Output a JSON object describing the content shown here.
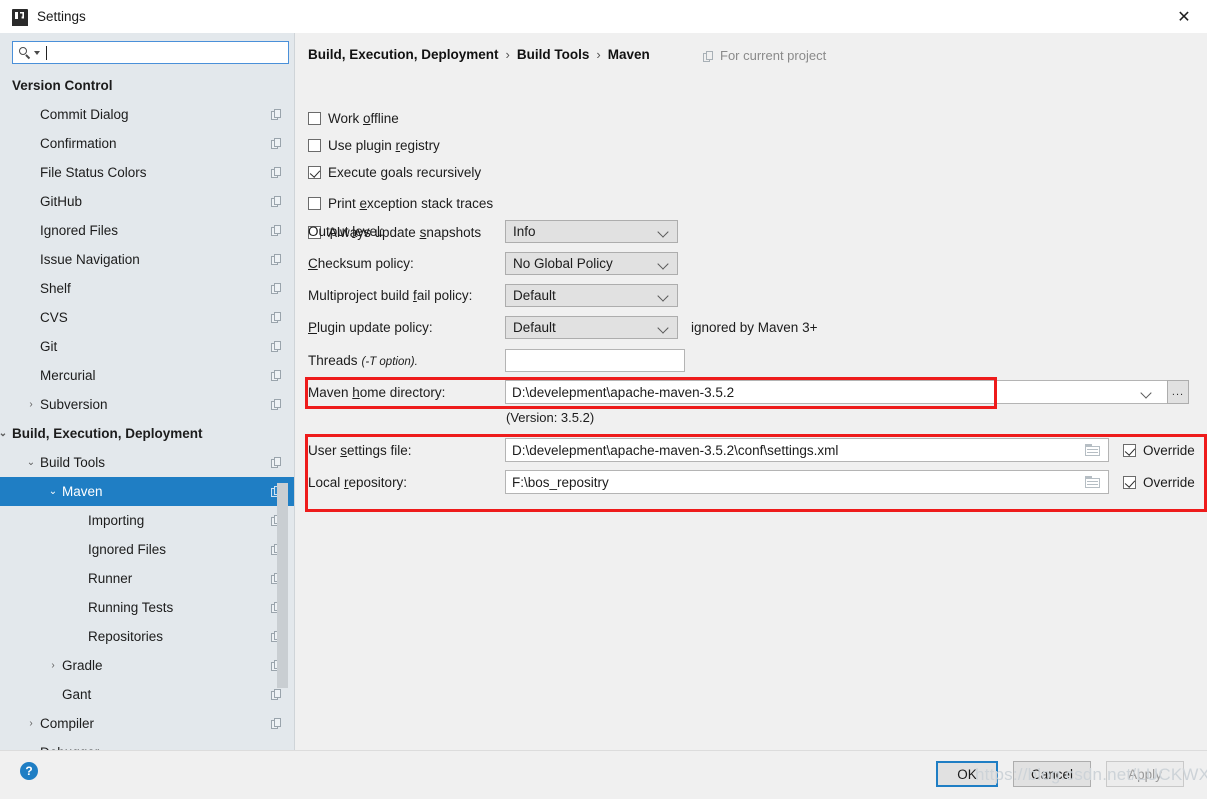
{
  "window": {
    "title": "Settings",
    "icon": "intellij-idea-icon",
    "close_label": "✕"
  },
  "sidebar": {
    "search": {
      "value": "",
      "placeholder": "",
      "icon": "search-icon"
    },
    "items": [
      {
        "label": "Version Control",
        "indent": 0,
        "bold": true,
        "arrow": "",
        "copy": false,
        "selected": false
      },
      {
        "label": "Commit Dialog",
        "indent": 1,
        "bold": false,
        "arrow": "",
        "copy": true,
        "selected": false
      },
      {
        "label": "Confirmation",
        "indent": 1,
        "bold": false,
        "arrow": "",
        "copy": true,
        "selected": false
      },
      {
        "label": "File Status Colors",
        "indent": 1,
        "bold": false,
        "arrow": "",
        "copy": true,
        "selected": false
      },
      {
        "label": "GitHub",
        "indent": 1,
        "bold": false,
        "arrow": "",
        "copy": true,
        "selected": false
      },
      {
        "label": "Ignored Files",
        "indent": 1,
        "bold": false,
        "arrow": "",
        "copy": true,
        "selected": false
      },
      {
        "label": "Issue Navigation",
        "indent": 1,
        "bold": false,
        "arrow": "",
        "copy": true,
        "selected": false
      },
      {
        "label": "Shelf",
        "indent": 1,
        "bold": false,
        "arrow": "",
        "copy": true,
        "selected": false
      },
      {
        "label": "CVS",
        "indent": 1,
        "bold": false,
        "arrow": "",
        "copy": true,
        "selected": false
      },
      {
        "label": "Git",
        "indent": 1,
        "bold": false,
        "arrow": "",
        "copy": true,
        "selected": false
      },
      {
        "label": "Mercurial",
        "indent": 1,
        "bold": false,
        "arrow": "",
        "copy": true,
        "selected": false
      },
      {
        "label": "Subversion",
        "indent": 1,
        "bold": false,
        "arrow": "›",
        "copy": true,
        "selected": false
      },
      {
        "label": "Build, Execution, Deployment",
        "indent": 0,
        "bold": true,
        "arrow": "⌄",
        "copy": false,
        "selected": false
      },
      {
        "label": "Build Tools",
        "indent": 1,
        "bold": false,
        "arrow": "⌄",
        "copy": true,
        "selected": false
      },
      {
        "label": "Maven",
        "indent": 2,
        "bold": false,
        "arrow": "⌄",
        "copy": true,
        "selected": true
      },
      {
        "label": "Importing",
        "indent": 3,
        "bold": false,
        "arrow": "",
        "copy": true,
        "selected": false
      },
      {
        "label": "Ignored Files",
        "indent": 3,
        "bold": false,
        "arrow": "",
        "copy": true,
        "selected": false
      },
      {
        "label": "Runner",
        "indent": 3,
        "bold": false,
        "arrow": "",
        "copy": true,
        "selected": false
      },
      {
        "label": "Running Tests",
        "indent": 3,
        "bold": false,
        "arrow": "",
        "copy": true,
        "selected": false
      },
      {
        "label": "Repositories",
        "indent": 3,
        "bold": false,
        "arrow": "",
        "copy": true,
        "selected": false
      },
      {
        "label": "Gradle",
        "indent": 2,
        "bold": false,
        "arrow": "›",
        "copy": true,
        "selected": false
      },
      {
        "label": "Gant",
        "indent": 2,
        "bold": false,
        "arrow": "",
        "copy": true,
        "selected": false
      },
      {
        "label": "Compiler",
        "indent": 1,
        "bold": false,
        "arrow": "›",
        "copy": true,
        "selected": false
      },
      {
        "label": "Debugger",
        "indent": 1,
        "bold": false,
        "arrow": "›",
        "copy": false,
        "selected": false
      }
    ]
  },
  "main": {
    "breadcrumb": [
      "Build, Execution, Deployment",
      "Build Tools",
      "Maven"
    ],
    "breadcrumb_separator": "›",
    "for_current_project": "For current project",
    "checkboxes": [
      {
        "label_pre": "Work ",
        "label_mnemonic": "o",
        "label_post": "ffline",
        "checked": false
      },
      {
        "label_pre": "Use plugin ",
        "label_mnemonic": "r",
        "label_post": "egistry",
        "checked": false
      },
      {
        "label_pre": "Execute ",
        "label_mnemonic": "g",
        "label_post": "oals recursively",
        "checked": true
      },
      {
        "label_pre": "Print ",
        "label_mnemonic": "e",
        "label_post": "xception stack traces",
        "checked": false
      },
      {
        "label_pre": "Always update ",
        "label_mnemonic": "s",
        "label_post": "napshots",
        "checked": false
      }
    ],
    "combos": [
      {
        "label_pre": "Output ",
        "label_mnemonic": "l",
        "label_post": "evel:",
        "value": "Info",
        "hint": ""
      },
      {
        "label_pre": "",
        "label_mnemonic": "C",
        "label_post": "hecksum policy:",
        "value": "No Global Policy",
        "hint": ""
      },
      {
        "label_pre": "Multiproject build ",
        "label_mnemonic": "f",
        "label_post": "ail policy:",
        "value": "Default",
        "hint": ""
      },
      {
        "label_pre": "",
        "label_mnemonic": "P",
        "label_post": "lugin update policy:",
        "value": "Default",
        "hint": "ignored by Maven 3+"
      }
    ],
    "threads": {
      "label": "Threads",
      "note": "(-T option).",
      "value": "",
      "placeholder": ""
    },
    "maven_home": {
      "label_pre": "Maven ",
      "label_mnemonic": "h",
      "label_post": "ome directory:",
      "value": "D:\\develepment\\apache-maven-3.5.2",
      "browse_label": "...",
      "version_note": "(Version: 3.5.2)"
    },
    "user_settings": {
      "label_pre": "User ",
      "label_mnemonic": "s",
      "label_post": "ettings file:",
      "value": "D:\\develepment\\apache-maven-3.5.2\\conf\\settings.xml",
      "override_label": "Override",
      "override_checked": true
    },
    "local_repository": {
      "label_pre": "Local ",
      "label_mnemonic": "r",
      "label_post": "epository:",
      "value": "F:\\bos_repositry",
      "override_label": "Override",
      "override_checked": true
    },
    "annotation_color": "#ee1b1b"
  },
  "footer": {
    "help_label": "?",
    "ok_label": "OK",
    "cancel_label": "Cancel",
    "apply_label": "Apply",
    "watermark": "https://blog.csdn.net/LUCKWXF"
  }
}
